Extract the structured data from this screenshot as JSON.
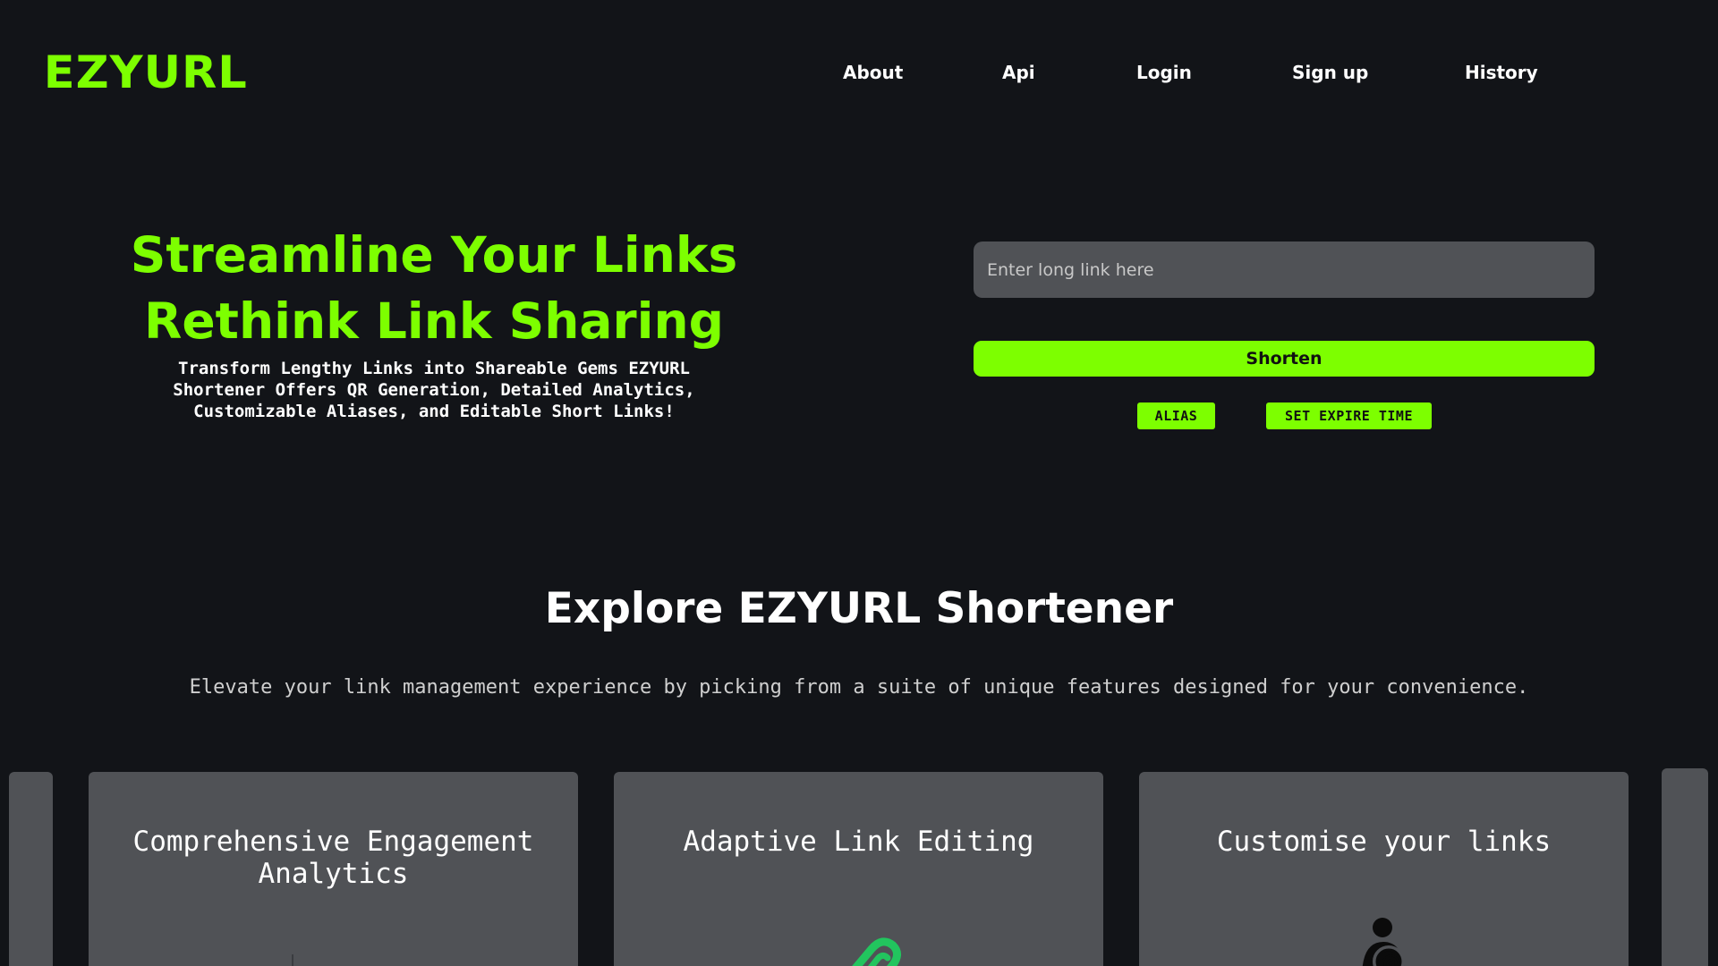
{
  "header": {
    "logo": "EZYURL",
    "nav": [
      {
        "label": "About"
      },
      {
        "label": "Api"
      },
      {
        "label": "Login"
      },
      {
        "label": "Sign up"
      },
      {
        "label": "History"
      }
    ]
  },
  "hero": {
    "title_line1": "Streamline Your Links",
    "title_line2": "Rethink Link Sharing",
    "subtitle": "Transform Lengthy Links into Shareable Gems EZYURL Shortener Offers QR Generation, Detailed Analytics, Customizable Aliases, and Editable Short Links!"
  },
  "form": {
    "link_placeholder": "Enter long link here",
    "shorten_label": "Shorten",
    "alias_label": "ALIAS",
    "expire_label": "SET EXPIRE TIME"
  },
  "explore": {
    "title": "Explore EZYURL Shortener",
    "subtitle": "Elevate your link management experience by picking from a suite of unique features designed for your convenience."
  },
  "cards": [
    {
      "title": "Comprehensive Engagement Analytics",
      "icon": "analytics-icon"
    },
    {
      "title": "Adaptive Link Editing",
      "icon": "link-edit-icon"
    },
    {
      "title": "Customise your links",
      "icon": "at-user-icon"
    }
  ],
  "colors": {
    "accent": "#7dff00",
    "background": "#121418",
    "card": "#505256",
    "input": "#505256"
  }
}
